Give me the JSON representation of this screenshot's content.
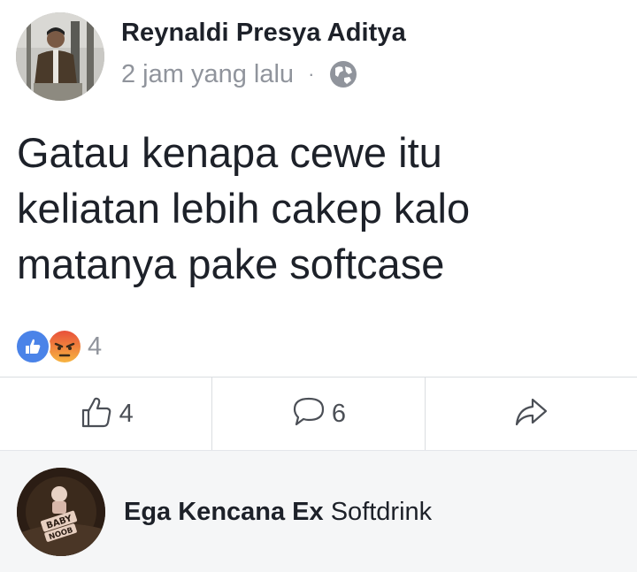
{
  "post": {
    "author": "Reynaldi Presya Aditya",
    "timestamp": "2 jam yang lalu",
    "separator": "·",
    "privacy_icon": "globe-icon",
    "text": "Gatau kenapa cewe itu\nkeliatan lebih cakep kalo\nmatanya pake softcase"
  },
  "reactions": {
    "icons": [
      "like-reaction-icon",
      "angry-reaction-icon"
    ],
    "count": "4"
  },
  "actions": {
    "like_count": "4",
    "comment_count": "6",
    "share_icon": "share-arrow-icon"
  },
  "comment": {
    "author": "Ega Kencana Ex",
    "text": "Softdrink",
    "avatar_text_1": "BABY",
    "avatar_text_2": "NOOB"
  },
  "colors": {
    "like_blue": "#4a83e8",
    "angry_orange": "#f0793a",
    "meta_gray": "#90949c",
    "comment_bg": "#f5f6f7"
  }
}
